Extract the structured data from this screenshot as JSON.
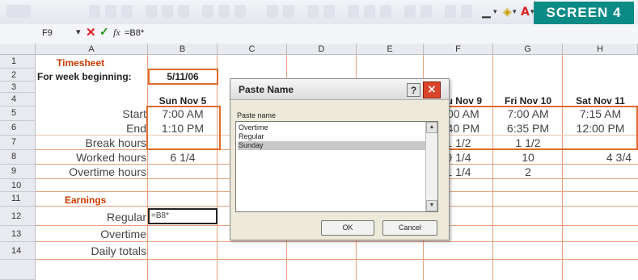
{
  "badge": "SCREEN 4",
  "formula_bar": {
    "name_box": "F9",
    "formula": "=B8*"
  },
  "columns": [
    "A",
    "B",
    "C",
    "D",
    "E",
    "F",
    "G",
    "H"
  ],
  "rows": [
    "1",
    "2",
    "3",
    "4",
    "5",
    "6",
    "7",
    "8",
    "9",
    "10",
    "11",
    "12",
    "13",
    "14"
  ],
  "cells": {
    "a1": "Timesheet",
    "a2": "For week beginning:",
    "b2": "5/11/06",
    "b4": "Sun Nov 5",
    "f4": "Thu Nov 9",
    "g4": "Fri Nov 10",
    "h4": "Sat Nov 11",
    "a5": "Start",
    "b5": "7:00 AM",
    "f5": "7:00 AM",
    "g5": "7:00 AM",
    "h5": "7:15 AM",
    "a6": "End",
    "b6": "1:10 PM",
    "f6": "5:40 PM",
    "g6": "6:35 PM",
    "h6": "12:00 PM",
    "a7": "Break hours",
    "f7": "1 1/2",
    "g7": "1 1/2",
    "a8": "Worked hours",
    "b8": "6 1/4",
    "f8": "9 1/4",
    "g8": "10",
    "h8": "4 3/4",
    "a9": "Overtime hours",
    "f9": "1 1/4",
    "g9": "2",
    "a11": "Earnings",
    "a12": "Regular",
    "b12": "=B8*",
    "a13": "Overtime",
    "a14": "Daily totals"
  },
  "dialog": {
    "title": "Paste Name",
    "help": "?",
    "close": "×",
    "label": "Paste name",
    "items": [
      "Overtime",
      "Regular",
      "Sunday"
    ],
    "selected_index": 2,
    "ok": "OK",
    "cancel": "Cancel"
  },
  "colors": {
    "badge": "#0a8b86",
    "highlight": "#e06a2a",
    "title_text": "#cc3a00"
  }
}
